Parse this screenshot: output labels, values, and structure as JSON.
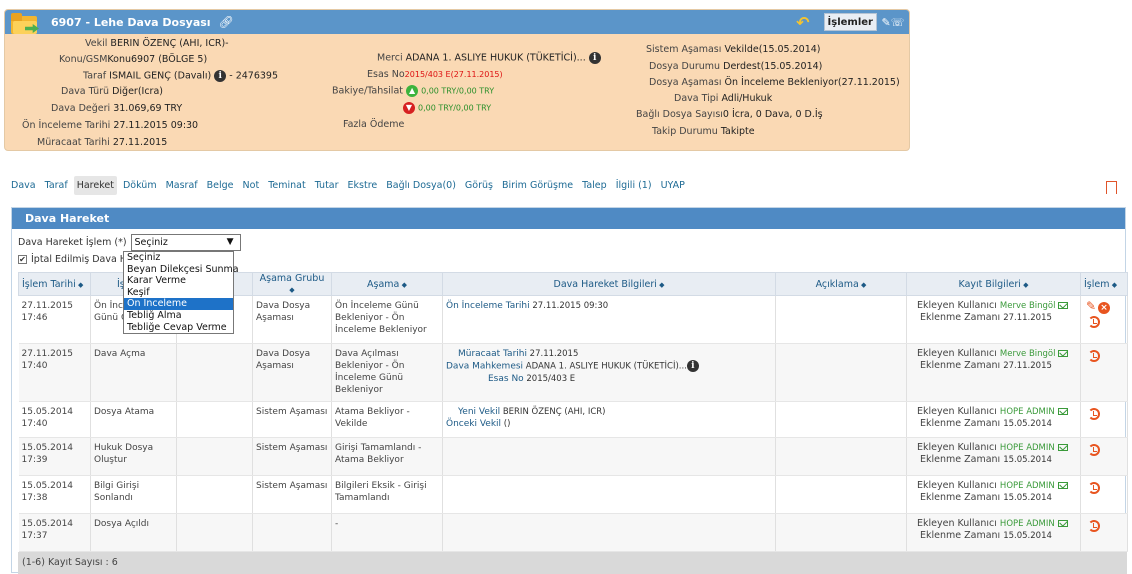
{
  "file": {
    "title": "6907 - Lehe Dava Dosyası",
    "actions_label": "İşlemler",
    "col1": {
      "vekil_label": "Vekil",
      "vekil_value": "BERIN ÖZENÇ (AHI, ICR)-",
      "konu_label": "Konu/GSM",
      "konu_value": "Konu6907 (BÖLGE 5)",
      "taraf_label": "Taraf",
      "taraf_value": "ISMAIL GENÇ (Davalı)",
      "taraf_phone": "- 2476395",
      "tur_label": "Dava Türü",
      "tur_value": "Diğer(Icra)",
      "deger_label": "Dava Değeri",
      "deger_value": "31.069,69 TRY",
      "oninceleme_label": "Ön İnceleme Tarihi",
      "oninceleme_value": "27.11.2015 09:30",
      "muracaat_label": "Müracaat Tarihi",
      "muracaat_value": "27.11.2015"
    },
    "col2": {
      "merci_label": "Merci",
      "merci_value": "ADANA 1. ASLIYE HUKUK (TÜKETİCİ)...",
      "esas_label": "Esas No",
      "esas_value": "2015/403 E(27.11.2015)",
      "bakiye_label": "Bakiye/Tahsilat",
      "bakiye_up": "0,00 TRY/0,00 TRY",
      "bakiye_down": "0,00 TRY/0,00 TRY",
      "fazla_label": "Fazla Ödeme"
    },
    "col3": {
      "sistem_label": "Sistem Aşaması",
      "sistem_value": "Vekilde(15.05.2014)",
      "durum_label": "Dosya Durumu",
      "durum_value": "Derdest(15.05.2014)",
      "asama_label": "Dosya Aşaması",
      "asama_value": "Ön İnceleme Bekleniyor(27.11.2015)",
      "tip_label": "Dava Tipi",
      "tip_value": "Adli/Hukuk",
      "bagli_label": "Bağlı Dosya Sayısı",
      "bagli_value": "0 İcra, 0 Dava, 0 D.İş",
      "takip_label": "Takip Durumu",
      "takip_value": "Takipte"
    }
  },
  "tabs": [
    "Dava",
    "Taraf",
    "Hareket",
    "Döküm",
    "Masraf",
    "Belge",
    "Not",
    "Teminat",
    "Tutar",
    "Ekstre",
    "Bağlı Dosya(0)",
    "Görüş",
    "Birim Görüşme",
    "Talep",
    "İlgili (1)",
    "UYAP"
  ],
  "active_tab": "Hareket",
  "panel": {
    "title": "Dava Hareket",
    "filter_label": "Dava Hareket İşlem (*)",
    "select_value": "Seçiniz",
    "cancel_label": "İptal Edilmiş Dava Hareketleri",
    "dropdown_options": [
      "Seçiniz",
      "Beyan Dilekçesi Sunma",
      "Karar Verme",
      "Keşif",
      "Ön İnceleme",
      "Tebliğ Alma",
      "Tebliğe Cevap Verme"
    ],
    "selected_option": "Ön İnceleme",
    "columns": [
      "İşlem Tarihi",
      "İşlem",
      "",
      "Aşama Grubu",
      "Aşama",
      "Dava Hareket Bilgileri",
      "Açıklama",
      "Kayıt Bilgileri",
      "İşlem"
    ],
    "footer": "(1-6) Kayıt Sayısı : 6",
    "kayit_labels": {
      "ekleyen": "Ekleyen Kullanıcı",
      "zaman": "Eklenme Zamanı"
    },
    "rows": [
      {
        "date": "27.11.2015",
        "time": "17:46",
        "islem": "Ön İnceleme Günü G",
        "grup": "Dava Dosya Aşaması",
        "asama": "Ön İnceleme Günü Bekleniyor - Ön İnceleme Bekleniyor",
        "bilgi": [
          {
            "l": "Ön İnceleme Tarihi",
            "v": "27.11.2015 09:30"
          }
        ],
        "user": "Merve Bingöl",
        "added": "27.11.2015"
      },
      {
        "date": "27.11.2015",
        "time": "17:40",
        "islem": "Dava Açma",
        "grup": "Dava Dosya Aşaması",
        "asama": "Dava Açılması Bekleniyor - Ön İnceleme Günü Bekleniyor",
        "bilgi": [
          {
            "l": "Müracaat Tarihi",
            "v": "27.11.2015"
          },
          {
            "l": "Dava Mahkemesi",
            "v": "ADANA 1. ASLIYE HUKUK (TÜKETİCİ)..."
          },
          {
            "l": "Esas No",
            "v": "2015/403 E"
          }
        ],
        "user": "Merve Bingöl",
        "added": "27.11.2015"
      },
      {
        "date": "15.05.2014",
        "time": "17:40",
        "islem": "Dosya Atama",
        "grup": "Sistem Aşaması",
        "asama": "Atama Bekliyor - Vekilde",
        "bilgi": [
          {
            "l": "Yeni Vekil",
            "v": "BERIN ÖZENÇ (AHI, ICR)"
          },
          {
            "l": "Önceki Vekil",
            "v": "()"
          }
        ],
        "user": "HOPE ADMIN",
        "added": "15.05.2014"
      },
      {
        "date": "15.05.2014",
        "time": "17:39",
        "islem": "Hukuk Dosya Oluştur",
        "grup": "Sistem Aşaması",
        "asama": "Girişi Tamamlandı - Atama Bekliyor",
        "bilgi": [],
        "user": "HOPE ADMIN",
        "added": "15.05.2014"
      },
      {
        "date": "15.05.2014",
        "time": "17:38",
        "islem": "Bilgi Girişi Sonlandı",
        "grup": "Sistem Aşaması",
        "asama": "Bilgileri Eksik - Girişi Tamamlandı",
        "bilgi": [],
        "user": "HOPE ADMIN",
        "added": "15.05.2014"
      },
      {
        "date": "15.05.2014",
        "time": "17:37",
        "islem": "Dosya Açıldı",
        "grup": "",
        "asama": "-",
        "bilgi": [],
        "user": "HOPE ADMIN",
        "added": "15.05.2014"
      }
    ]
  }
}
